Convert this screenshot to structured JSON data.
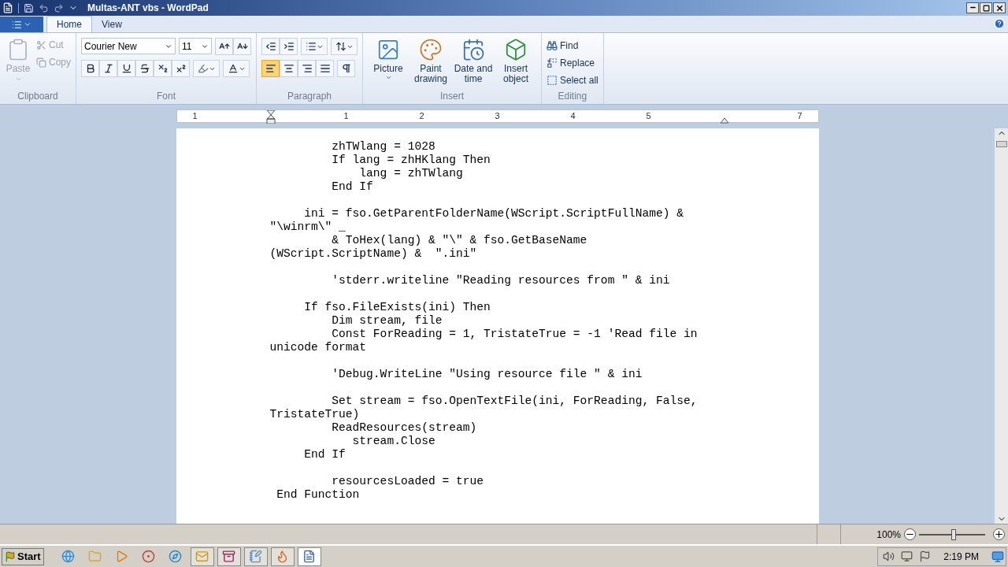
{
  "window": {
    "title": "Multas-ANT vbs - WordPad"
  },
  "tabs": [
    {
      "label": "Home",
      "selected": true
    },
    {
      "label": "View",
      "selected": false
    }
  ],
  "clipboard": {
    "label": "Clipboard",
    "paste": {
      "label": "Paste",
      "disabled": true
    },
    "cut": {
      "label": "Cut",
      "disabled": true
    },
    "copy": {
      "label": "Copy",
      "disabled": true
    }
  },
  "font": {
    "label": "Font",
    "family": "Courier New",
    "size": "11"
  },
  "paragraph": {
    "label": "Paragraph",
    "alignments": [
      {
        "kind": "left",
        "selected": true
      },
      {
        "kind": "center",
        "selected": false
      },
      {
        "kind": "right",
        "selected": false
      },
      {
        "kind": "justify",
        "selected": false
      }
    ]
  },
  "insert": {
    "label": "Insert",
    "items": [
      {
        "kind": "picture",
        "label": "Picture"
      },
      {
        "kind": "paint",
        "label": "Paint\ndrawing"
      },
      {
        "kind": "datetime",
        "label": "Date and\ntime"
      },
      {
        "kind": "object",
        "label": "Insert\nobject"
      }
    ]
  },
  "editing": {
    "label": "Editing",
    "items": [
      {
        "kind": "find",
        "label": "Find"
      },
      {
        "kind": "replace",
        "label": "Replace"
      },
      {
        "kind": "selectall",
        "label": "Select all"
      }
    ]
  },
  "ruler": {
    "labels": [
      "1",
      "1",
      "2",
      "3",
      "4",
      "5",
      "7"
    ]
  },
  "document": {
    "blocks": [
      {
        "lines": [
          "         zhTWlang = 1028",
          "         If lang = zhHKlang Then",
          "             lang = zhTWlang",
          "         End If"
        ]
      },
      {
        "lines": [
          "     ini = fso.GetParentFolderName(WScript.ScriptFullName) &",
          "\"\\winrm\\\" _",
          "         & ToHex(lang) & \"\\\" & fso.GetBaseName",
          "(WScript.ScriptName) &  \".ini\""
        ]
      },
      {
        "lines": [
          "         'stderr.writeline \"Reading resources from \" & ini"
        ]
      },
      {
        "lines": [
          "     If fso.FileExists(ini) Then",
          "         Dim stream, file",
          "         Const ForReading = 1, TristateTrue = -1 'Read file in",
          "unicode format"
        ]
      },
      {
        "lines": [
          "         'Debug.WriteLine \"Using resource file \" & ini"
        ]
      },
      {
        "lines": [
          "         Set stream = fso.OpenTextFile(ini, ForReading, False,",
          "TristateTrue)",
          "         ReadResources(stream)",
          "            stream.Close",
          "     End If"
        ]
      },
      {
        "lines": [
          "         resourcesLoaded = true",
          " End Function"
        ]
      }
    ]
  },
  "status_bar": {
    "zoom": "100%",
    "zoom_slider": {
      "level": 0.52
    }
  },
  "taskbar": {
    "start": "Start",
    "clock": "2:19 PM",
    "apps": [
      {
        "kind": "browser",
        "running": false,
        "selected": false
      },
      {
        "kind": "folder",
        "running": false,
        "selected": false
      },
      {
        "kind": "media",
        "running": false,
        "selected": false
      },
      {
        "kind": "chrome",
        "running": false,
        "selected": false
      },
      {
        "kind": "edge",
        "running": false,
        "selected": false
      },
      {
        "kind": "mail",
        "running": true,
        "selected": false
      },
      {
        "kind": "archive",
        "running": true,
        "selected": false
      },
      {
        "kind": "notepad",
        "running": true,
        "selected": false
      },
      {
        "kind": "firefox",
        "running": true,
        "selected": false
      },
      {
        "kind": "wordpad",
        "running": true,
        "selected": true
      }
    ]
  }
}
